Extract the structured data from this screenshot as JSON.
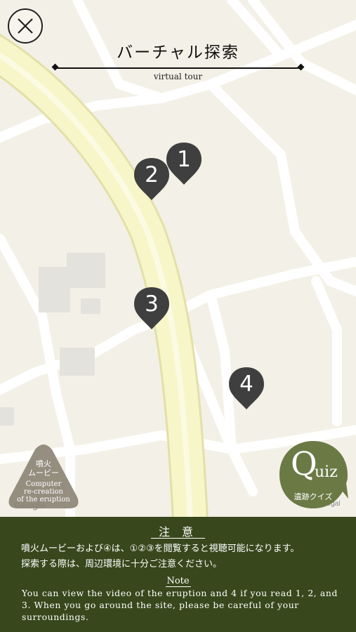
{
  "header": {
    "title": "バーチャル探索",
    "subtitle": "virtual tour"
  },
  "close_button": {
    "icon": "close-icon"
  },
  "map": {
    "pins": [
      {
        "label": "1"
      },
      {
        "label": "2"
      },
      {
        "label": "3"
      },
      {
        "label": "4"
      }
    ],
    "attribution": "Google",
    "legal": "Legal"
  },
  "movie_button": {
    "jp_line1": "噴火",
    "jp_line2": "ムービー",
    "en_line1": "Computer",
    "en_line2": "re-creation",
    "en_line3": "of the eruption"
  },
  "quiz_button": {
    "big": "Q",
    "rest": "uiz",
    "jp": "遺跡クイズ"
  },
  "notice": {
    "title": "注 意",
    "jp_line1": "噴火ムービーおよび④は、①②③を閲覧すると視聴可能になります。",
    "jp_line2": "探索する際は、周辺環境に十分ご注意ください。",
    "en_title": "Note",
    "en_text": "You can view the video of the eruption and 4 if you read 1, 2, and 3. When you go around the site, please be careful of your surroundings."
  },
  "colors": {
    "pin": "#3f3f3f",
    "notice_bg": "#38471c",
    "quiz_bg": "#6b7a45",
    "movie_bg": "#8c8576",
    "map_bg": "#f3f0e7",
    "main_road": "#f7f6c9"
  }
}
